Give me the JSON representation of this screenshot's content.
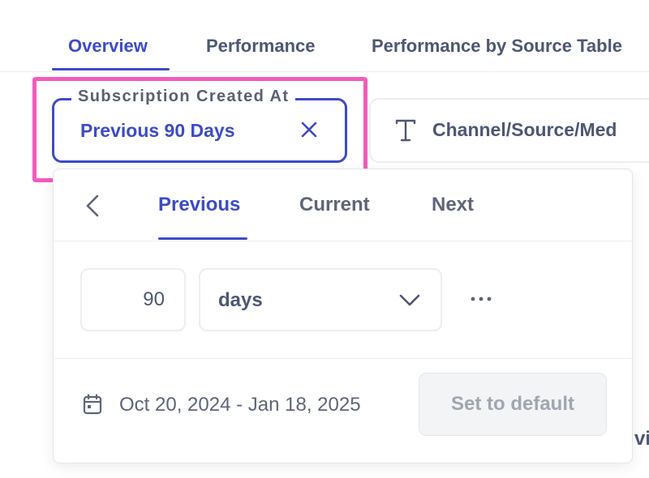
{
  "tabs": [
    {
      "label": "Overview",
      "active": true
    },
    {
      "label": "Performance",
      "active": false
    },
    {
      "label": "Performance by Source Table",
      "active": false
    }
  ],
  "filter": {
    "legend": "Subscription Created At",
    "value": "Previous 90 Days",
    "highlight_color": "#f25bbd",
    "accent_color": "#3d4bc7"
  },
  "second_filter": {
    "label": "Channel/Source/Med",
    "icon": "text-type-icon"
  },
  "popover": {
    "tabs": [
      {
        "label": "Previous",
        "active": true
      },
      {
        "label": "Current",
        "active": false
      },
      {
        "label": "Next",
        "active": false
      }
    ],
    "amount": "90",
    "unit": "days",
    "date_range": "Oct 20, 2024 - Jan 18, 2025",
    "default_button": "Set to default"
  },
  "background_peek": "vi"
}
